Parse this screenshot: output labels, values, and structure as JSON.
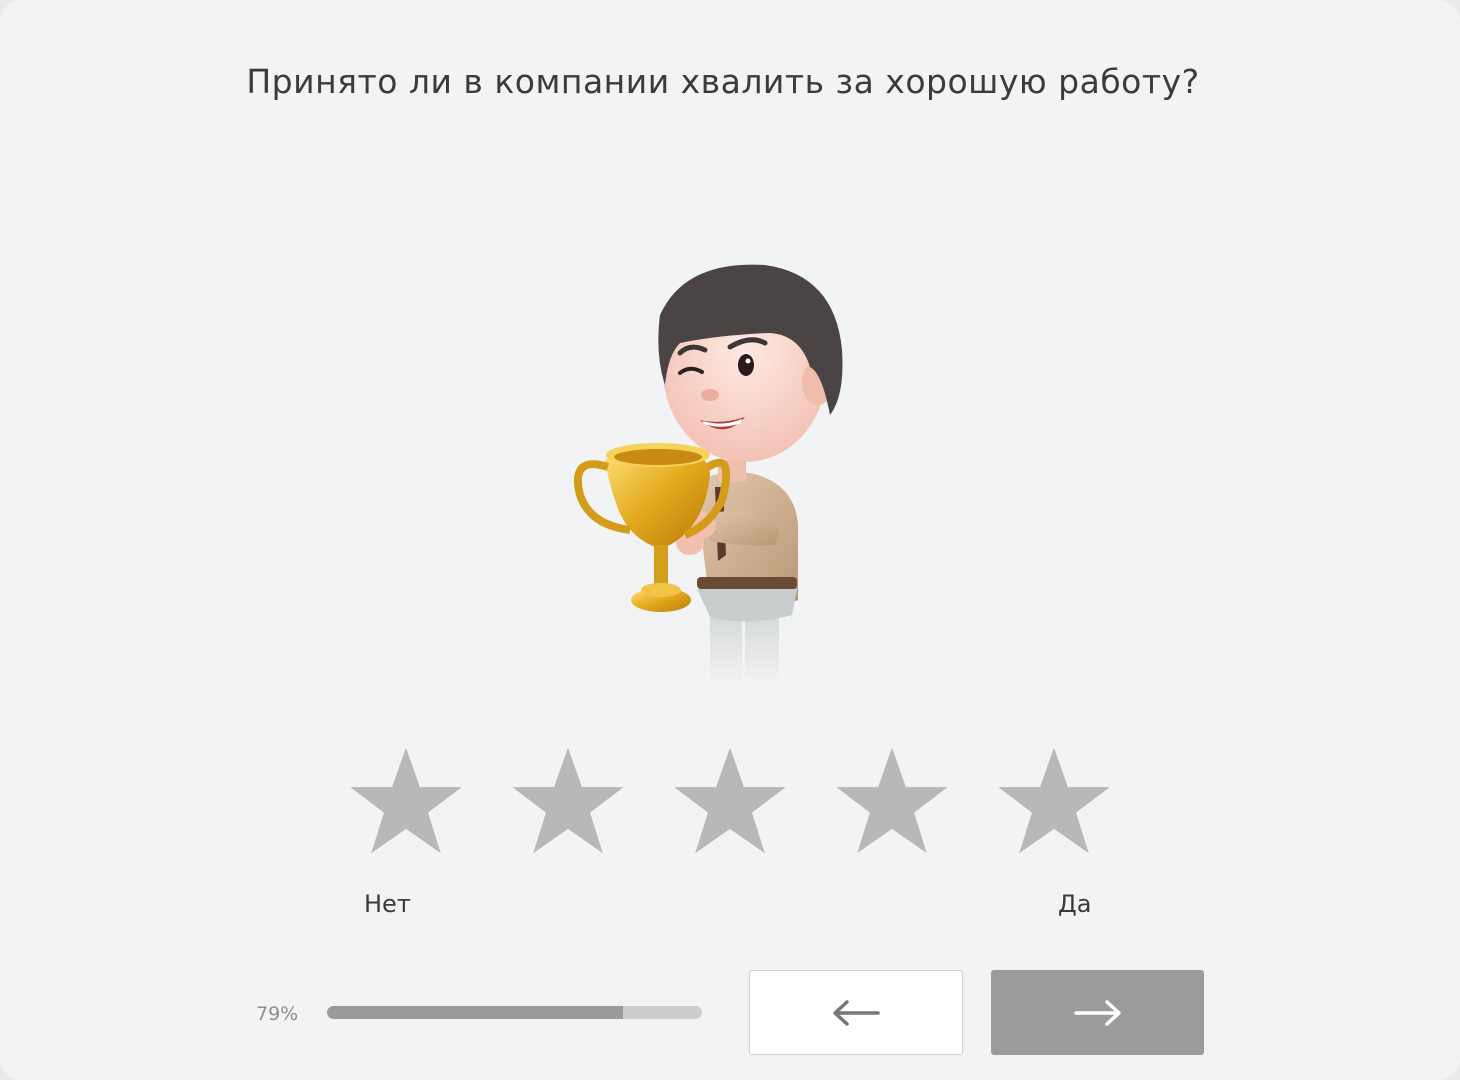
{
  "question": {
    "text": "Принято ли в компании хвалить за хорошую работу?"
  },
  "illustration": {
    "icon": "man-with-trophy-illustration"
  },
  "rating": {
    "max": 5,
    "selected": 0,
    "star_color": "#b8b8b8",
    "low_label": "Нет",
    "high_label": "Да"
  },
  "progress": {
    "label": "79%",
    "value": 0.79,
    "fill_color": "#9a9a9a",
    "track_color": "#cdcdcd"
  },
  "nav": {
    "back_icon": "arrow-left-icon",
    "next_icon": "arrow-right-icon",
    "next_color": "#9b9b9b"
  }
}
